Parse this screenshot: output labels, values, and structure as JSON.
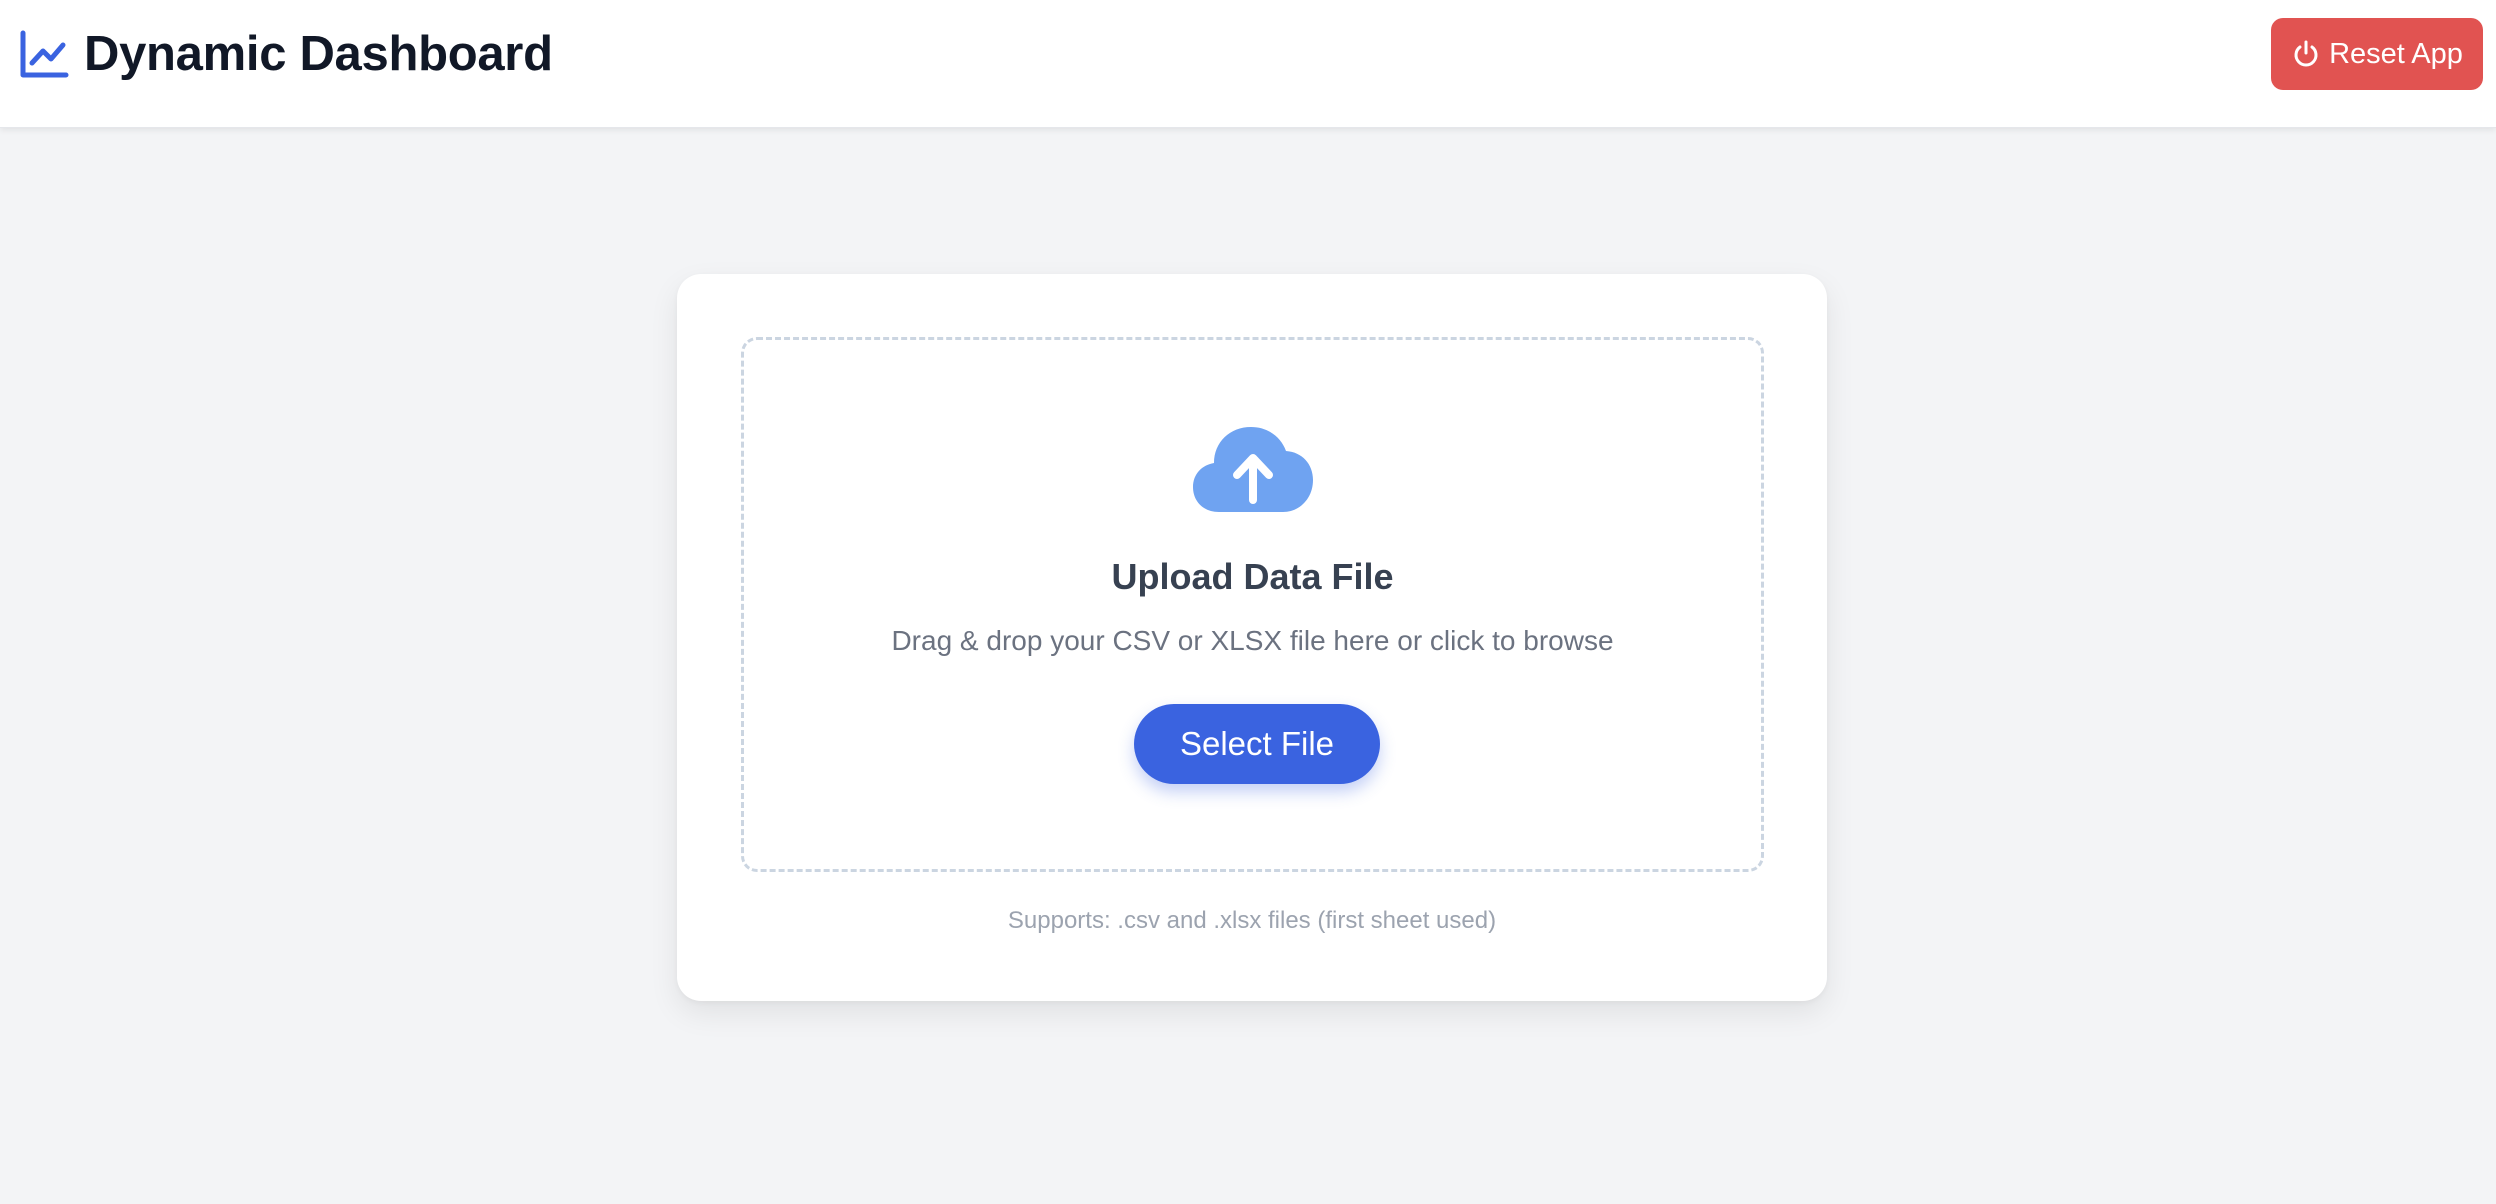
{
  "header": {
    "title": "Dynamic Dashboard",
    "logo_icon": "chart-line-icon",
    "reset_label": "Reset App",
    "reset_icon": "power-icon"
  },
  "upload": {
    "icon": "cloud-upload-icon",
    "title": "Upload Data File",
    "description": "Drag & drop your CSV or XLSX file here or click to browse",
    "button_label": "Select File",
    "supports": "Supports: .csv and .xlsx files (first sheet used)"
  },
  "colors": {
    "brand_blue": "#3a63e0",
    "reset_red": "#e15351",
    "cloud_blue": "#6fa3f1",
    "background": "#f3f4f6",
    "dashed_border": "#cbd5e1"
  }
}
